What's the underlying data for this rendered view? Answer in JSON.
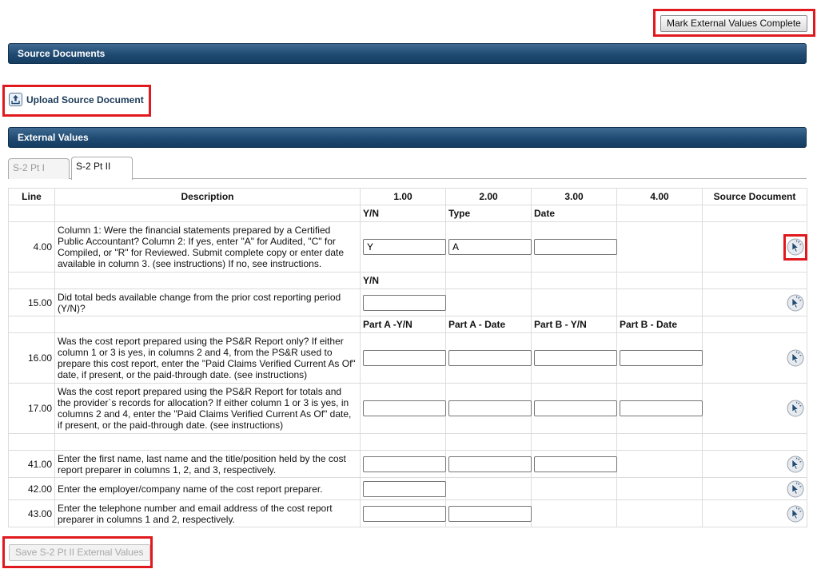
{
  "toolbar": {
    "mark_complete_label": "Mark External Values Complete"
  },
  "source_documents": {
    "section_title": "Source Documents",
    "upload_label": "Upload Source Document"
  },
  "external_values": {
    "section_title": "External Values",
    "tabs": [
      {
        "label": "S-2 Pt I",
        "active": false
      },
      {
        "label": "S-2 Pt II",
        "active": true
      }
    ],
    "columns": [
      "Line",
      "Description",
      "1.00",
      "2.00",
      "3.00",
      "4.00",
      "Source Document"
    ],
    "subheaders": {
      "group1": [
        "Y/N",
        "Type",
        "Date",
        ""
      ],
      "group2": [
        "Y/N",
        "",
        "",
        ""
      ],
      "group3": [
        "Part A -Y/N",
        "Part A - Date",
        "Part B - Y/N",
        "Part B - Date"
      ]
    },
    "rows": {
      "r4": {
        "line": "4.00",
        "description": "Column 1: Were the financial statements prepared by a Certified Public Accountant? Column 2: If yes, enter \"A\" for Audited, \"C\" for Compiled, or \"R\" for Reviewed. Submit complete copy or enter date available in column 3. (see instructions) If no, see instructions.",
        "values": [
          "Y",
          "A",
          ""
        ]
      },
      "r15": {
        "line": "15.00",
        "description": "Did total beds available change from the prior cost reporting period (Y/N)?",
        "values": [
          ""
        ]
      },
      "r16": {
        "line": "16.00",
        "description": "Was the cost report prepared using the PS&R Report only? If either column 1 or 3 is yes, in columns 2 and 4, from the PS&R used to prepare this cost report, enter the \"Paid Claims Verified Current As Of\" date, if present, or the paid-through date. (see instructions)",
        "values": [
          "",
          "",
          "",
          ""
        ]
      },
      "r17": {
        "line": "17.00",
        "description": "Was the cost report prepared using the PS&R Report for totals and the provider`s records for allocation? If either column 1 or 3 is yes, in columns 2 and 4, enter the \"Paid Claims Verified Current As Of\" date, if present, or the paid-through date. (see instructions)",
        "values": [
          "",
          "",
          "",
          ""
        ]
      },
      "r41": {
        "line": "41.00",
        "description": "Enter the first name, last name and the title/position held by the cost report preparer in columns 1, 2, and 3, respectively.",
        "values": [
          "",
          "",
          ""
        ]
      },
      "r42": {
        "line": "42.00",
        "description": "Enter the employer/company name of the cost report preparer.",
        "values": [
          ""
        ]
      },
      "r43": {
        "line": "43.00",
        "description": "Enter the telephone number and email address of the cost report preparer in columns 1 and 2, respectively.",
        "values": [
          "",
          ""
        ]
      }
    },
    "save_label": "Save S-2 Pt II External Values"
  },
  "colors": {
    "section_bar": "#1f4a72",
    "highlight": "#e0191e"
  }
}
